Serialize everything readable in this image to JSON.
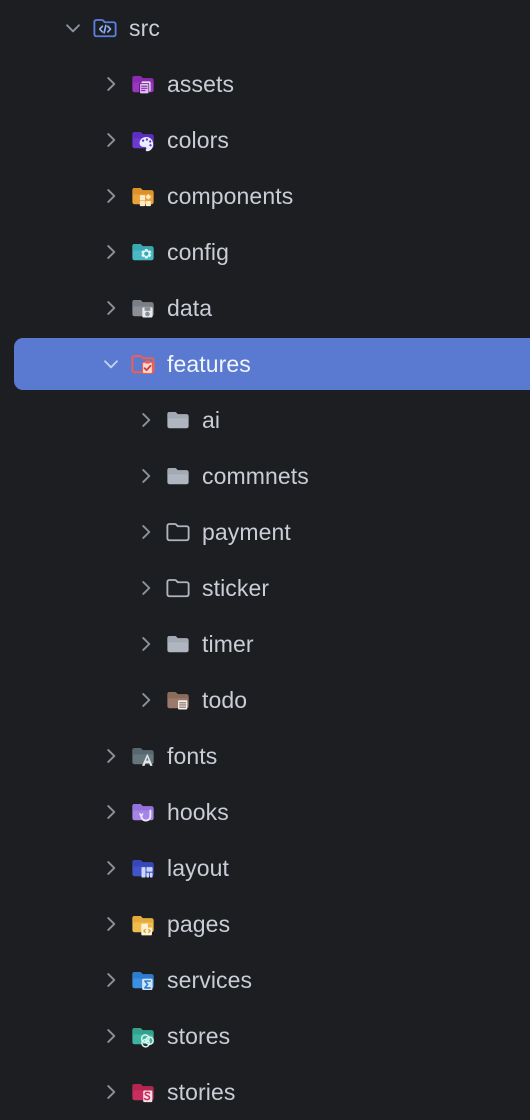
{
  "theme": {
    "background": "#1c1e22",
    "text": "#c9ced6",
    "text_selected": "#f2f5fb",
    "selection": "#5a79d0",
    "chevron": "#8b929c"
  },
  "tree": {
    "name": "file-explorer-tree",
    "items": [
      {
        "label": "src",
        "level": 0,
        "expanded": true,
        "selected": false,
        "chevron": "chevron-down-icon",
        "icon": "folder-src-code-icon"
      },
      {
        "label": "assets",
        "level": 1,
        "expanded": false,
        "selected": false,
        "chevron": "chevron-right-icon",
        "icon": "folder-assets-icon"
      },
      {
        "label": "colors",
        "level": 1,
        "expanded": false,
        "selected": false,
        "chevron": "chevron-right-icon",
        "icon": "folder-colors-palette-icon"
      },
      {
        "label": "components",
        "level": 1,
        "expanded": false,
        "selected": false,
        "chevron": "chevron-right-icon",
        "icon": "folder-components-icon"
      },
      {
        "label": "config",
        "level": 1,
        "expanded": false,
        "selected": false,
        "chevron": "chevron-right-icon",
        "icon": "folder-config-gear-icon"
      },
      {
        "label": "data",
        "level": 1,
        "expanded": false,
        "selected": false,
        "chevron": "chevron-right-icon",
        "icon": "folder-data-disk-icon"
      },
      {
        "label": "features",
        "level": 1,
        "expanded": true,
        "selected": true,
        "chevron": "chevron-down-icon",
        "icon": "folder-features-checklist-icon"
      },
      {
        "label": "ai",
        "level": 2,
        "expanded": false,
        "selected": false,
        "chevron": "chevron-right-icon",
        "icon": "folder-filled-icon"
      },
      {
        "label": "commnets",
        "level": 2,
        "expanded": false,
        "selected": false,
        "chevron": "chevron-right-icon",
        "icon": "folder-filled-icon"
      },
      {
        "label": "payment",
        "level": 2,
        "expanded": false,
        "selected": false,
        "chevron": "chevron-right-icon",
        "icon": "folder-outline-icon"
      },
      {
        "label": "sticker",
        "level": 2,
        "expanded": false,
        "selected": false,
        "chevron": "chevron-right-icon",
        "icon": "folder-outline-icon"
      },
      {
        "label": "timer",
        "level": 2,
        "expanded": false,
        "selected": false,
        "chevron": "chevron-right-icon",
        "icon": "folder-filled-icon"
      },
      {
        "label": "todo",
        "level": 2,
        "expanded": false,
        "selected": false,
        "chevron": "chevron-right-icon",
        "icon": "folder-todo-list-icon"
      },
      {
        "label": "fonts",
        "level": 1,
        "expanded": false,
        "selected": false,
        "chevron": "chevron-right-icon",
        "icon": "folder-fonts-letter-icon"
      },
      {
        "label": "hooks",
        "level": 1,
        "expanded": false,
        "selected": false,
        "chevron": "chevron-right-icon",
        "icon": "folder-hooks-icon"
      },
      {
        "label": "layout",
        "level": 1,
        "expanded": false,
        "selected": false,
        "chevron": "chevron-right-icon",
        "icon": "folder-layout-grid-icon"
      },
      {
        "label": "pages",
        "level": 1,
        "expanded": false,
        "selected": false,
        "chevron": "chevron-right-icon",
        "icon": "folder-pages-icon"
      },
      {
        "label": "services",
        "level": 1,
        "expanded": false,
        "selected": false,
        "chevron": "chevron-right-icon",
        "icon": "folder-services-sigma-icon"
      },
      {
        "label": "stores",
        "level": 1,
        "expanded": false,
        "selected": false,
        "chevron": "chevron-right-icon",
        "icon": "folder-stores-redux-icon"
      },
      {
        "label": "stories",
        "level": 1,
        "expanded": false,
        "selected": false,
        "chevron": "chevron-right-icon",
        "icon": "folder-stories-storybook-icon"
      }
    ]
  }
}
